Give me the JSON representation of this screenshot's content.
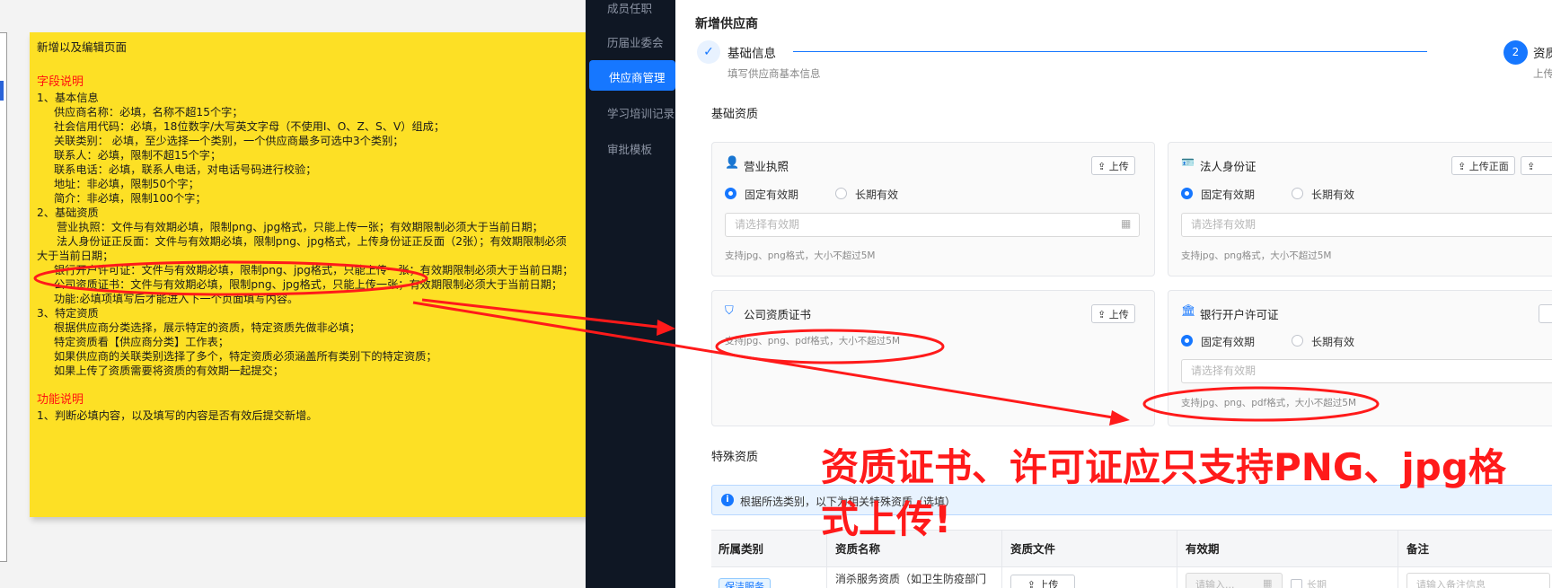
{
  "sticky_note": {
    "title": "新增以及编辑页面",
    "field_header": "字段说明",
    "lines": [
      "1、基本信息",
      "供应商名称：必填，名称不超15个字；",
      "社会信用代码：必填，18位数字/大写英文字母（不使用I、O、Z、S、V）组成；",
      "关联类别：  必填，至少选择一个类别，一个供应商最多可选中3个类别；",
      "联系人：必填，限制不超15个字；",
      "联系电话：必填，联系人电话，对电话号码进行校验；",
      "地址：非必填，限制50个字；",
      "简介：非必填，限制100个字；",
      "2、基础资质",
      "营业执照：文件与有效期必填，限制png、jpg格式，只能上传一张；有效期限制必须大于当前日期；",
      "法人身份证正反面：文件与有效期必填，限制png、jpg格式，上传身份证正反面（2张）；有效期限制必须",
      "大于当前日期；",
      "银行开户许可证：文件与有效期必填，限制png、jpg格式，只能上传一张；有效期限制必须大于当前日期；",
      "公司资质证书：文件与有效期必填，限制png、jpg格式，只能上传一张；有效期限制必须大于当前日期；",
      "功能:必填项填写后才能进入下一个页面填写内容。",
      "3、特定资质",
      "根据供应商分类选择，展示特定的资质，特定资质先做非必填；",
      "特定资质看【供应商分类】工作表；",
      "如果供应商的关联类别选择了多个，特定资质必须涵盖所有类别下的特定资质；",
      "如果上传了资质需要将资质的有效期一起提交；"
    ],
    "func_header": "功能说明",
    "func_line": "1、判断必填内容，以及填写的内容是否有效后提交新增。"
  },
  "sidebar": {
    "items": [
      "成员任职",
      "历届业委会",
      "供应商管理",
      "学习培训记录",
      "审批模板"
    ],
    "active_index": 2
  },
  "page": {
    "title": "新增供应商",
    "step1_title": "基础信息",
    "step1_desc": "填写供应商基本信息",
    "step2_num": "2",
    "step2_title": "资质",
    "step2_desc": "上传"
  },
  "basic": {
    "header": "基础资质",
    "cards": {
      "license": {
        "title": "营业执照",
        "upload": "上传",
        "fixed": "固定有效期",
        "long": "长期有效",
        "placeholder": "请选择有效期",
        "hint": "支持jpg、png格式，大小不超过5M"
      },
      "idcard": {
        "title": "法人身份证",
        "upload_front": "上传正面",
        "fixed": "固定有效期",
        "long": "长期有效",
        "placeholder": "请选择有效期",
        "hint": "支持jpg、png格式，大小不超过5M"
      },
      "cert": {
        "title": "公司资质证书",
        "upload": "上传",
        "hint": "支持jpg、png、pdf格式，大小不超过5M"
      },
      "bank": {
        "title": "银行开户许可证",
        "fixed": "固定有效期",
        "long": "长期有效",
        "placeholder": "请选择有效期",
        "hint": "支持jpg、png、pdf格式，大小不超过5M"
      }
    }
  },
  "special": {
    "header": "特殊资质",
    "info": "根据所选类别，以下为相关特殊资质（选填）",
    "columns": [
      "所属类别",
      "资质名称",
      "资质文件",
      "有效期",
      "备注"
    ],
    "row": {
      "category": "保洁服务",
      "name": "消杀服务资质（如卫生防疫部门",
      "upload": "上传",
      "date_placeholder": "请输入...",
      "long": "长期",
      "remark_placeholder": "请输入备注信息"
    }
  },
  "annotation": {
    "text": "资质证书、许可证应只支持PNG、jpg格式上传!",
    "color": "#ff1a1a"
  },
  "colors": {
    "accent": "#1677ff",
    "sticky": "#fde025",
    "sidebar": "#0f1724"
  }
}
